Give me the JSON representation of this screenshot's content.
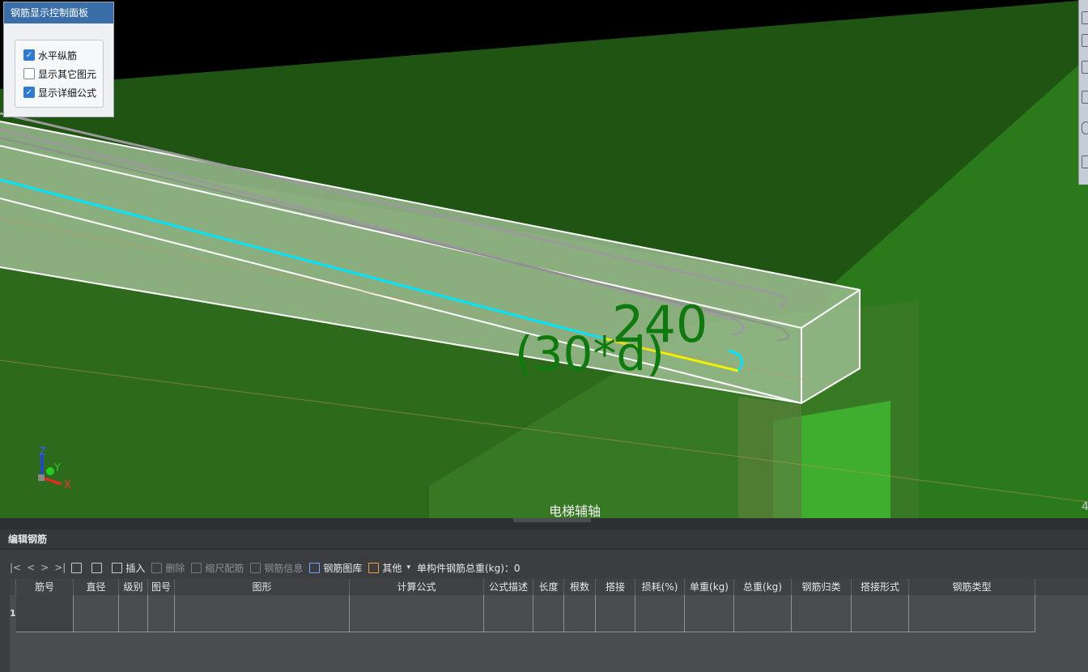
{
  "viewport": {
    "dimension_label": "240",
    "formula_label": "(30*d)",
    "axis_name": "电梯辅轴",
    "edge_number": "4",
    "axis_gizmo": {
      "z": "Z",
      "y": "Y",
      "x": "X"
    }
  },
  "display_panel": {
    "title": "钢筋显示控制面板",
    "options": [
      {
        "label": "水平纵筋",
        "checked": true
      },
      {
        "label": "显示其它图元",
        "checked": false
      },
      {
        "label": "显示详细公式",
        "checked": true
      }
    ]
  },
  "editor": {
    "title": "编辑钢筋",
    "nav": [
      "|<",
      "<",
      ">",
      ">|"
    ],
    "toolbar": {
      "insert": "插入",
      "delete": "删除",
      "scale_rebar": "缩尺配筋",
      "rebar_info": "钢筋信息",
      "rebar_library": "钢筋图库",
      "other": "其他",
      "total_weight": "单构件钢筋总重(kg)：0"
    },
    "columns": [
      "筋号",
      "直径(mm)",
      "级别",
      "图号",
      "图形",
      "计算公式",
      "公式描述",
      "长度",
      "根数",
      "搭接",
      "损耗(%)",
      "单重(kg)",
      "总重(kg)",
      "钢筋归类",
      "搭接形式",
      "钢筋类型"
    ],
    "row_number": "1"
  },
  "colors": {
    "model_green": "#2f6f1f",
    "rebar_cyan": "#00e5ff",
    "rebar_yellow": "#f2f200",
    "panel_header": "#3a6ea8"
  }
}
